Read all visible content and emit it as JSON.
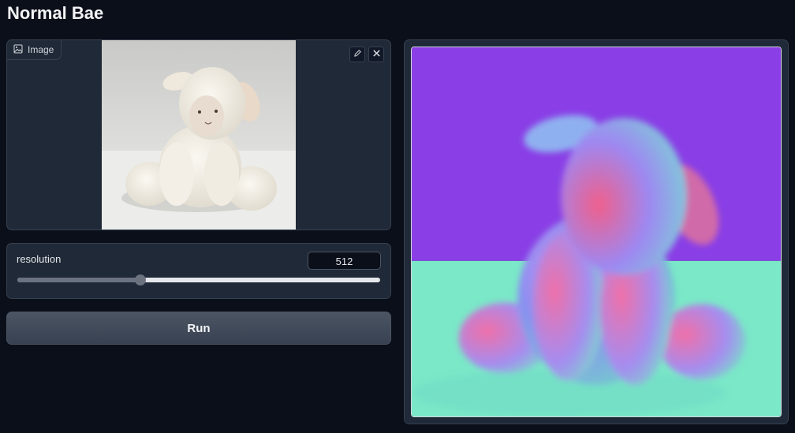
{
  "app": {
    "title": "Normal Bae"
  },
  "input_image": {
    "label": "Image",
    "icon": "image-icon",
    "edit_icon": "pencil-icon",
    "clear_icon": "close-icon"
  },
  "resolution": {
    "label": "resolution",
    "value": "512",
    "fraction": 0.34
  },
  "run": {
    "label": "Run"
  },
  "output_image": {
    "description_icon": "output-image"
  },
  "colors": {
    "background": "#0b0f19",
    "panel": "#1f2937",
    "border": "#374151",
    "normal_purple": "#8a3fe6",
    "normal_teal": "#7be8c8"
  }
}
